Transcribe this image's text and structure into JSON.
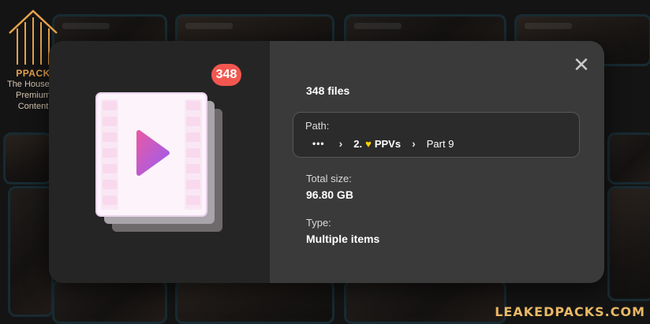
{
  "brand": {
    "name": "PPACK",
    "tagline": "The House of Premium Content"
  },
  "watermark": "LEAKEDPACKS.COM",
  "modal": {
    "badge_count": "348",
    "files_count": "348 files",
    "path": {
      "label": "Path:",
      "ellipsis": "•••",
      "segments": [
        "2.",
        "PPVs",
        "Part 9"
      ],
      "heart": "♥"
    },
    "total_size": {
      "label": "Total size:",
      "value": "96.80 GB"
    },
    "type": {
      "label": "Type:",
      "value": "Multiple items"
    },
    "close_glyph": "✕",
    "icon": "video-files-icon"
  },
  "colors": {
    "badge": "#f2574f",
    "brand": "#e6a24a",
    "watermark": "#e9b865",
    "heart": "#ffd400",
    "play_gradient": [
      "#e45aa8",
      "#9b5cf0"
    ]
  }
}
